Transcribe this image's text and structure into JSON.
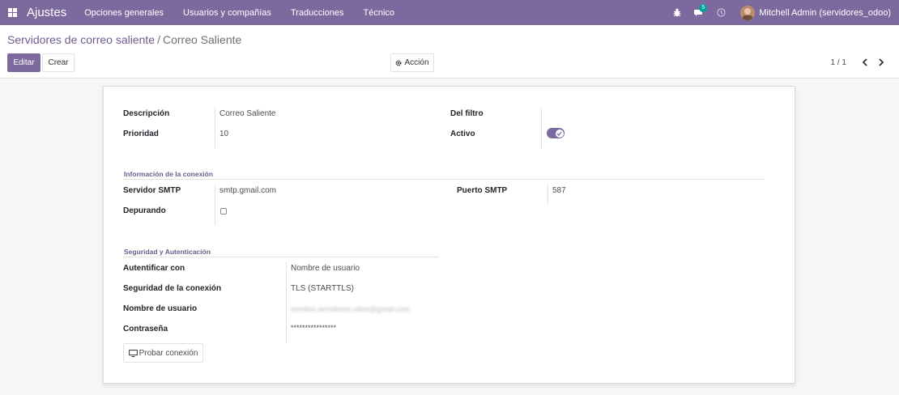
{
  "navbar": {
    "app_title": "Ajustes",
    "menu": [
      "Opciones generales",
      "Usuarios y compañías",
      "Traducciones",
      "Técnico"
    ],
    "messages_count": "5",
    "user_name": "Mitchell Admin (servidores_odoo)",
    "icons": [
      "apps-grid-icon",
      "bug-icon",
      "chat-icon",
      "clock-icon"
    ],
    "accent_color": "#7c6a9e"
  },
  "breadcrumb": {
    "parent": "Servidores de correo saliente",
    "separator": "/",
    "current": "Correo Saliente"
  },
  "buttons": {
    "edit": "Editar",
    "create": "Crear",
    "action": "Acción"
  },
  "pager": {
    "value": "1 / 1"
  },
  "form": {
    "description_label": "Descripción",
    "description_value": "Correo Saliente",
    "priority_label": "Prioridad",
    "priority_value": "10",
    "filter_label": "Del filtro",
    "active_label": "Activo",
    "active_value": true,
    "connection_section": "Información de la conexión",
    "smtp_server_label": "Servidor SMTP",
    "smtp_server_value": "smtp.gmail.com",
    "smtp_port_label": "Puerto SMTP",
    "smtp_port_value": "587",
    "debug_label": "Depurando",
    "debug_value": false,
    "security_section": "Seguridad y Autenticación",
    "auth_label": "Autentificar con",
    "auth_value": "Nombre de usuario",
    "conn_security_label": "Seguridad de la conexión",
    "conn_security_value": "TLS (STARTTLS)",
    "username_label": "Nombre de usuario",
    "username_value": "nombre.servidores.odoo@gmail.com",
    "password_label": "Contraseña",
    "password_value": "****************",
    "test_button": "Probar conexión"
  }
}
